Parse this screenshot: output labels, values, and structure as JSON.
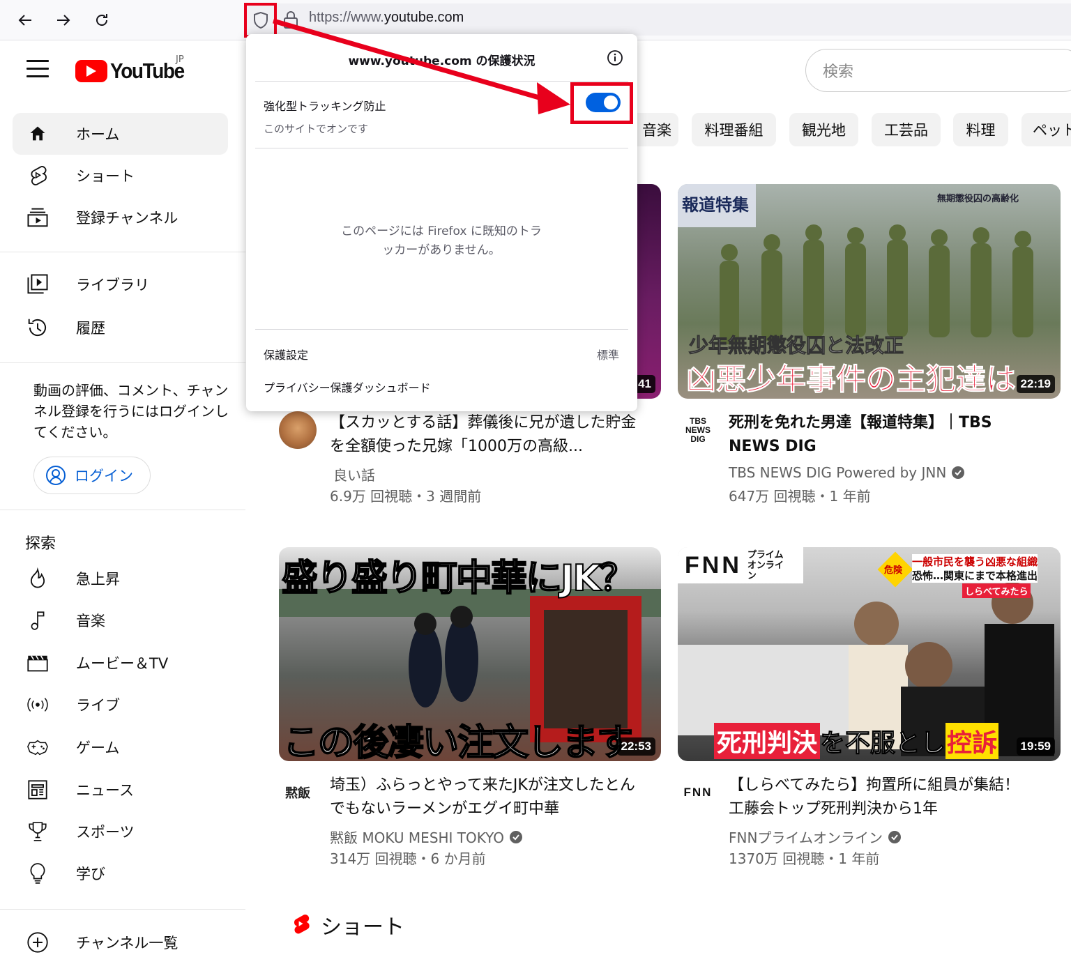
{
  "browser": {
    "url_prefix": "https://www.",
    "url_domain": "youtube.com",
    "icons": {
      "back": "arrow-left-icon",
      "forward": "arrow-right-icon",
      "reload": "reload-icon",
      "shield": "shield-icon",
      "lock": "lock-icon"
    }
  },
  "youtube": {
    "logo_text": "YouTube",
    "region": "JP",
    "search_placeholder": "検索",
    "brand_color": "#ff0000"
  },
  "sidebar": {
    "main": [
      {
        "label": "ホーム",
        "icon": "home-icon",
        "active": true
      },
      {
        "label": "ショート",
        "icon": "shorts-icon"
      },
      {
        "label": "登録チャンネル",
        "icon": "subscriptions-icon"
      }
    ],
    "library": [
      {
        "label": "ライブラリ",
        "icon": "library-icon"
      },
      {
        "label": "履歴",
        "icon": "history-icon"
      }
    ],
    "login_message": "動画の評価、コメント、チャンネル登録を行うにはログインしてください。",
    "login_button": "ログイン",
    "explore_title": "探索",
    "explore": [
      {
        "label": "急上昇",
        "icon": "trending-icon"
      },
      {
        "label": "音楽",
        "icon": "music-icon"
      },
      {
        "label": "ムービー＆TV",
        "icon": "movies-icon"
      },
      {
        "label": "ライブ",
        "icon": "live-icon"
      },
      {
        "label": "ゲーム",
        "icon": "gaming-icon"
      },
      {
        "label": "ニュース",
        "icon": "news-icon"
      },
      {
        "label": "スポーツ",
        "icon": "sports-icon"
      },
      {
        "label": "学び",
        "icon": "learning-icon"
      }
    ],
    "channels": {
      "label": "チャンネル一覧",
      "icon": "add-circle-icon"
    }
  },
  "chips": [
    "音楽",
    "料理番組",
    "観光地",
    "工芸品",
    "料理",
    "ペット"
  ],
  "videos": [
    {
      "title": "【スカッとする話】葬儀後に兄が遺した貯金を全額使った兄嫁「1000万の高級...",
      "channel": "良い話",
      "verified": false,
      "meta": "6.9万 回視聴・3 週間前",
      "duration": "41"
    },
    {
      "title": "死刑を免れた男達【報道特集】｜TBS NEWS DIG",
      "channel": "TBS NEWS DIG Powered by JNN",
      "verified": true,
      "meta": "647万 回視聴・1 年前",
      "duration": "22:19",
      "thumb_tag": "報道特集",
      "thumb_corner": "無期懲役囚の高齢化",
      "thumb_caption1": "少年無期懲役囚と法改正",
      "thumb_caption2": "凶悪少年事件の主犯達は"
    },
    {
      "title": "埼玉）ふらっとやって来たJKが注文したとんでもないラーメンがエグイ町中華",
      "channel": "黙飯 MOKU MESHI TOKYO",
      "verified": true,
      "meta": "314万 回視聴・6 か月前",
      "duration": "22:53",
      "thumb_caption1": "盛り盛り町中華にJK？",
      "thumb_caption2": "この後凄い注文します"
    },
    {
      "title": "【しらべてみたら】拘置所に組員が集結！工藤会トップ死刑判決から1年",
      "channel": "FNNプライムオンライン",
      "verified": true,
      "meta": "1370万 回視聴・1 年前",
      "duration": "19:59",
      "thumb_logo": "FNN",
      "thumb_logo_sub": "プライム オンライン",
      "thumb_badge": "危険",
      "thumb_line1": "一般市民を襲う凶悪な組織",
      "thumb_line2": "恐怖…関東にまで本格進出",
      "thumb_tag": "しらべてみたら",
      "thumb_caption_a": "死刑判決",
      "thumb_caption_b": "を不服とし",
      "thumb_caption_c": "控訴"
    }
  ],
  "channel_avatars": {
    "tbs": "TBS NEWS DIG",
    "moku": "黙飯",
    "fnn": "FNN"
  },
  "shorts_title": "ショート",
  "popup": {
    "title": "www.youtube.com の保護状況",
    "tracking_label": "強化型トラッキング防止",
    "tracking_sub": "このサイトでオンです",
    "tracking_on": true,
    "empty_message": "このページには Firefox に既知のトラッカーがありません。",
    "settings_label": "保護設定",
    "settings_value": "標準",
    "dashboard_label": "プライバシー保護ダッシュボード",
    "accent_color": "#0061e0",
    "highlight_color": "#e8001c"
  }
}
